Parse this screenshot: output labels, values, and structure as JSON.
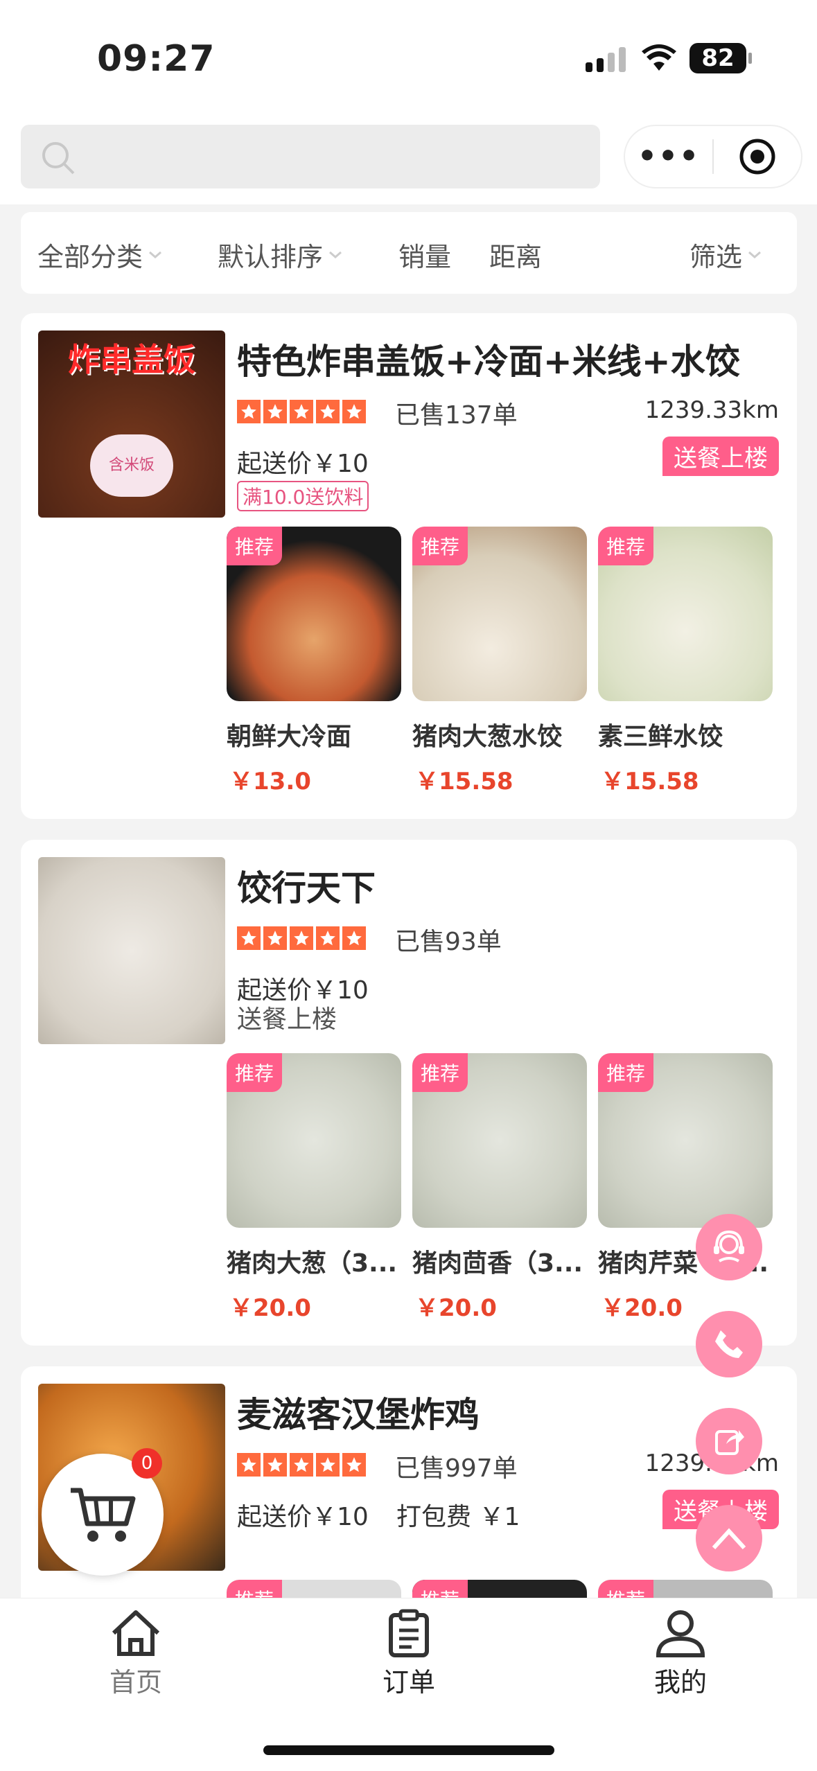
{
  "status": {
    "time": "09:27",
    "battery": "82"
  },
  "filters": {
    "all_categories": "全部分类",
    "default_sort": "默认排序",
    "sales": "销量",
    "distance": "距离",
    "filter": "筛选"
  },
  "shops": [
    {
      "name": "特色炸串盖饭+冷面+米线+水饺",
      "sold": "已售137单",
      "distance": "1239.33km",
      "delivery_tag": "送餐上楼",
      "min_order": "起送价￥10",
      "promo": "满10.0送饮料",
      "thumb_text": "炸串盖饭",
      "thumb_sub": "含米饭",
      "dishes": [
        {
          "badge": "推荐",
          "name": "朝鲜大冷面",
          "price": "￥13.0"
        },
        {
          "badge": "推荐",
          "name": "猪肉大葱水饺",
          "price": "￥15.58"
        },
        {
          "badge": "推荐",
          "name": "素三鲜水饺",
          "price": "￥15.58"
        }
      ]
    },
    {
      "name": "饺行天下",
      "sold": "已售93单",
      "min_order": "起送价￥10",
      "delivery_text": "送餐上楼",
      "dishes": [
        {
          "badge": "推荐",
          "name": "猪肉大葱（3...",
          "price": "￥20.0"
        },
        {
          "badge": "推荐",
          "name": "猪肉茴香（3...",
          "price": "￥20.0"
        },
        {
          "badge": "推荐",
          "name": "猪肉芹菜（3...",
          "price": "￥20.0"
        }
      ]
    },
    {
      "name": "麦滋客汉堡炸鸡",
      "sold": "已售997单",
      "distance": "1239.33km",
      "delivery_tag": "送餐上楼",
      "min_order": "起送价￥10",
      "packing": "打包费 ￥1",
      "dishes": [
        {
          "badge": "推荐"
        },
        {
          "badge": "推荐"
        },
        {
          "badge": "推荐"
        }
      ]
    }
  ],
  "cart": {
    "count": "0"
  },
  "tabs": [
    {
      "label": "首页",
      "icon": "home-icon"
    },
    {
      "label": "订单",
      "icon": "order-icon"
    },
    {
      "label": "我的",
      "icon": "user-icon"
    }
  ],
  "colors": {
    "accent": "#ff5e8a",
    "price": "#e8452c",
    "star": "#ff6a3d"
  }
}
